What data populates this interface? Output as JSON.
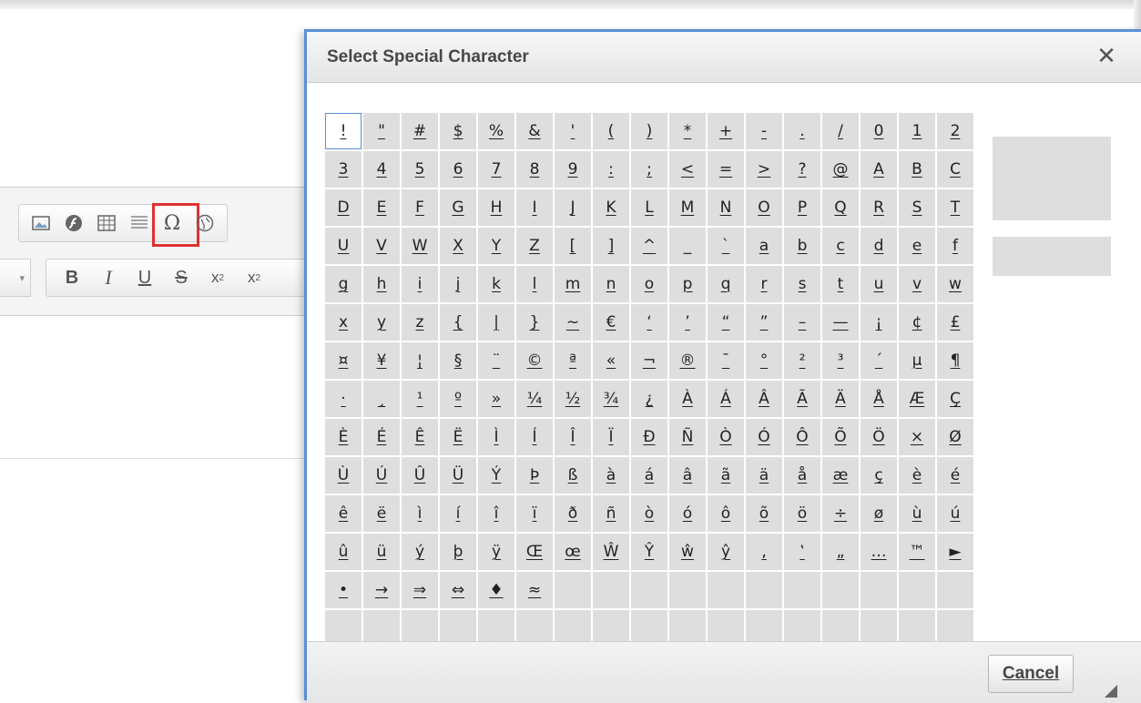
{
  "toolbar": {
    "row1_icons": [
      "image-icon",
      "flash-icon",
      "table-icon",
      "horizontal-rule-icon",
      "special-char-icon",
      "iframe-icon"
    ],
    "row2_buttons": [
      "B",
      "I",
      "U",
      "S",
      "x",
      "x"
    ],
    "subscript_mark": "2",
    "superscript_mark": "2"
  },
  "dialog": {
    "title": "Select Special Character",
    "close_label": "✕",
    "cancel_label": "Cancel",
    "characters": [
      "!",
      "\"",
      "#",
      "$",
      "%",
      "&",
      "'",
      "(",
      ")",
      "*",
      "+",
      "-",
      ".",
      "/",
      "0",
      "1",
      "2",
      "3",
      "4",
      "5",
      "6",
      "7",
      "8",
      "9",
      ":",
      ";",
      "<",
      "=",
      ">",
      "?",
      "@",
      "A",
      "B",
      "C",
      "D",
      "E",
      "F",
      "G",
      "H",
      "I",
      "J",
      "K",
      "L",
      "M",
      "N",
      "O",
      "P",
      "Q",
      "R",
      "S",
      "T",
      "U",
      "V",
      "W",
      "X",
      "Y",
      "Z",
      "[",
      "]",
      "^",
      "_",
      "`",
      "a",
      "b",
      "c",
      "d",
      "e",
      "f",
      "g",
      "h",
      "i",
      "j",
      "k",
      "l",
      "m",
      "n",
      "o",
      "p",
      "q",
      "r",
      "s",
      "t",
      "u",
      "v",
      "w",
      "x",
      "y",
      "z",
      "{",
      "|",
      "}",
      "~",
      "€",
      "‘",
      "’",
      "“",
      "”",
      "–",
      "—",
      "¡",
      "¢",
      "£",
      "¤",
      "¥",
      "¦",
      "§",
      "¨",
      "©",
      "ª",
      "«",
      "¬",
      "®",
      "¯",
      "°",
      "²",
      "³",
      "´",
      "µ",
      "¶",
      "·",
      "¸",
      "¹",
      "º",
      "»",
      "¼",
      "½",
      "¾",
      "¿",
      "À",
      "Á",
      "Â",
      "Ã",
      "Ä",
      "Å",
      "Æ",
      "Ç",
      "È",
      "É",
      "Ê",
      "Ë",
      "Ì",
      "Í",
      "Î",
      "Ï",
      "Ð",
      "Ñ",
      "Ò",
      "Ó",
      "Ô",
      "Õ",
      "Ö",
      "×",
      "Ø",
      "Ù",
      "Ú",
      "Û",
      "Ü",
      "Ý",
      "Þ",
      "ß",
      "à",
      "á",
      "â",
      "ã",
      "ä",
      "å",
      "æ",
      "ç",
      "è",
      "é",
      "ê",
      "ë",
      "ì",
      "í",
      "î",
      "ï",
      "ð",
      "ñ",
      "ò",
      "ó",
      "ô",
      "õ",
      "ö",
      "÷",
      "ø",
      "ù",
      "ú",
      "û",
      "ü",
      "ý",
      "þ",
      "ÿ",
      "Œ",
      "œ",
      "Ŵ",
      "Ŷ",
      "ŵ",
      "ŷ",
      "‚",
      "‛",
      "„",
      "…",
      "™",
      "►",
      "•",
      "→",
      "⇒",
      "⇔",
      "♦",
      "≈"
    ],
    "selected_index": 0
  }
}
